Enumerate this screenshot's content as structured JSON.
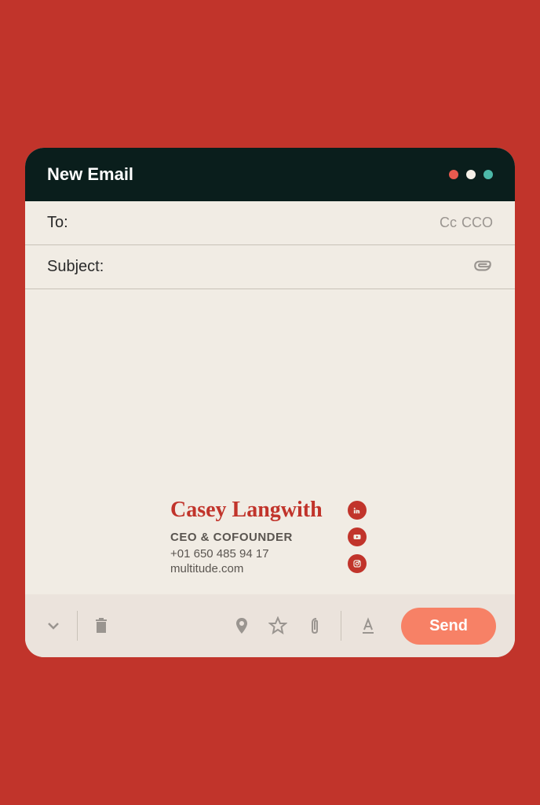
{
  "window": {
    "title": "New Email"
  },
  "fields": {
    "to_label": "To:",
    "cc_label": "Cc",
    "cco_label": "CCO",
    "subject_label": "Subject:"
  },
  "signature": {
    "name": "Casey Langwith",
    "title": "CEO & COFOUNDER",
    "phone": "+01 650 485 94 17",
    "website": "multitude.com"
  },
  "toolbar": {
    "send_label": "Send"
  },
  "colors": {
    "background": "#c1342b",
    "window_bg": "#f1ece4",
    "titlebar": "#0a1e1c",
    "accent": "#c1342b",
    "send_button": "#f78166"
  }
}
